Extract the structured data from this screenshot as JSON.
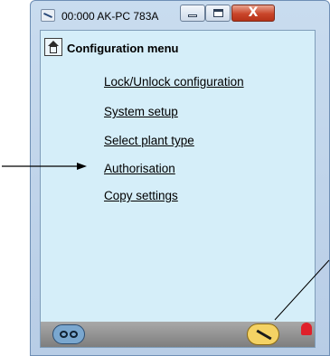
{
  "window": {
    "title": "00:000 AK-PC 783A",
    "close_label": "X"
  },
  "menu": {
    "title": "Configuration menu",
    "items": [
      {
        "label": "Lock/Unlock configuration"
      },
      {
        "label": "System setup"
      },
      {
        "label": "Select plant type"
      },
      {
        "label": "Authorisation"
      },
      {
        "label": "Copy settings"
      }
    ]
  },
  "icons": {
    "title": "window-app-icon",
    "home": "home-icon",
    "status_left": "glasses-icon",
    "status_mid": "wrench-icon",
    "status_right": "alarm-icon"
  }
}
